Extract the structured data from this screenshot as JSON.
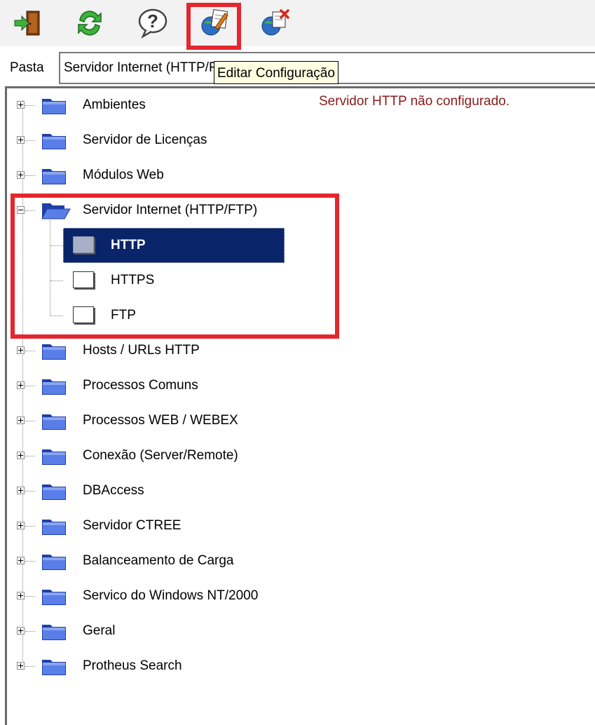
{
  "toolbar": {
    "buttons": [
      {
        "name": "exit-button",
        "icon": "exit-door-icon"
      },
      {
        "name": "refresh-button",
        "icon": "refresh-icon"
      },
      {
        "name": "help-button",
        "icon": "help-icon"
      },
      {
        "name": "edit-config-button",
        "icon": "edit-config-icon"
      },
      {
        "name": "delete-config-button",
        "icon": "delete-config-icon"
      }
    ],
    "highlight_color": "#e5262d"
  },
  "pasta": {
    "label": "Pasta",
    "value": "Servidor Internet (HTTP/FTP)"
  },
  "tooltip": {
    "text": "Editar Configuração"
  },
  "status_message": "Servidor HTTP não configurado.",
  "tree": {
    "items_before": [
      {
        "label": "Ambientes"
      },
      {
        "label": "Servidor de Licenças"
      },
      {
        "label": "Módulos Web"
      }
    ],
    "expanded": {
      "label": "Servidor Internet (HTTP/FTP)",
      "children": [
        {
          "label": "HTTP",
          "selected": true
        },
        {
          "label": "HTTPS",
          "selected": false
        },
        {
          "label": "FTP",
          "selected": false
        }
      ]
    },
    "items_after": [
      {
        "label": "Hosts / URLs HTTP"
      },
      {
        "label": "Processos Comuns"
      },
      {
        "label": "Processos WEB / WEBEX"
      },
      {
        "label": "Conexão (Server/Remote)"
      },
      {
        "label": "DBAccess"
      },
      {
        "label": "Servidor CTREE"
      },
      {
        "label": "Balanceamento de Carga"
      },
      {
        "label": "Servico do Windows NT/2000"
      },
      {
        "label": "Geral"
      },
      {
        "label": "Protheus Search"
      }
    ]
  },
  "colors": {
    "selection_bg": "#0a246a",
    "folder_blue": "#3a5bd9",
    "status_text": "#8b1a1a",
    "tooltip_bg": "#ffffe1"
  }
}
